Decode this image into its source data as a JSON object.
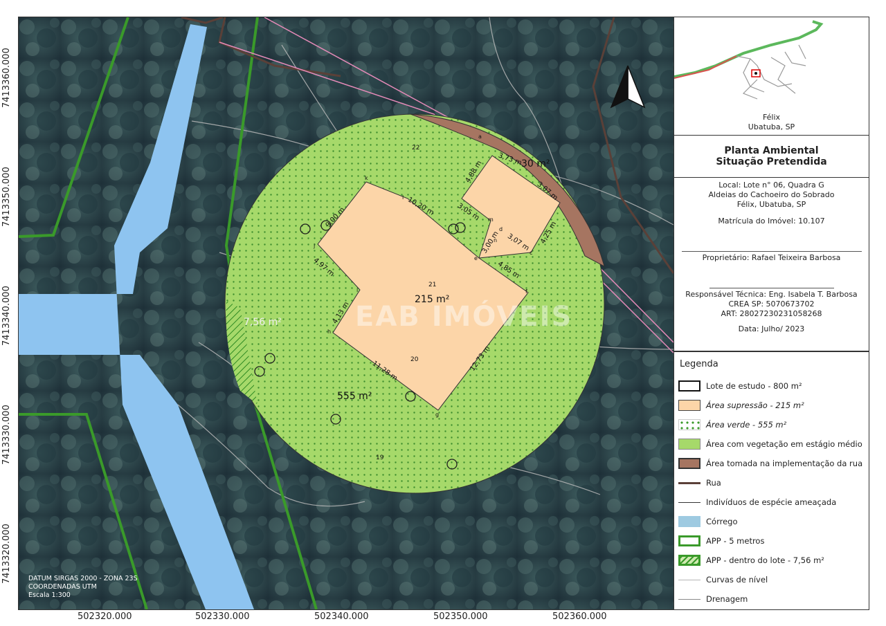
{
  "axes": {
    "y_ticks": [
      "7413360.000",
      "7413350.000",
      "7413340.000",
      "7413330.000",
      "7413320.000"
    ],
    "x_ticks": [
      "502320.000",
      "502330.000",
      "502340.000",
      "502350.000",
      "502360.000"
    ]
  },
  "map": {
    "areas": {
      "supressao": "215 m²",
      "verde": "555 m²",
      "rua": "30 m²",
      "app": "7,56 m²"
    },
    "dimensions": [
      "10,20 m",
      "4,97 m",
      "4,13 m",
      "11,28 m",
      "12,73 m",
      "4,85 m",
      "3,07 m",
      "3,00 m",
      "3,05 m",
      "4,88 m",
      "3,73 m",
      "3,07 m",
      "4,25 m",
      "9,00 m"
    ],
    "contours": [
      "22",
      "21",
      "20",
      "19"
    ],
    "vertex_labels": [
      "m",
      "n",
      "d",
      "e",
      "f",
      "g",
      "h",
      "i",
      "j",
      "k",
      "l",
      "c",
      "a"
    ],
    "watermark": "EAB IMÓVEIS",
    "datum": [
      "DATUM SIRGAS 2000 - ZONA 23S",
      "COORDENADAS UTM",
      "Escala 1:300"
    ]
  },
  "locator": {
    "place": "Félix",
    "city": "Ubatuba, SP"
  },
  "title": {
    "line1": "Planta Ambiental",
    "line2": "Situação Pretendida"
  },
  "info": {
    "local": "Local: Lote n° 06, Quadra G",
    "loteamento": "Aldeias do Cachoeiro do Sobrado",
    "cidade": "Félix, Ubatuba, SP",
    "matricula": "Matrícula do Imóvel: 10.107",
    "proprietario": "Proprietário: Rafael Teixeira Barbosa",
    "responsavel": "Responsável Técnica: Eng. Isabela T. Barbosa",
    "crea": "CREA SP: 5070673702",
    "art": "ART: 28027230231058268",
    "data": "Data: Julho/ 2023"
  },
  "legend": {
    "title": "Legenda",
    "items": [
      {
        "label": "Lote de estudo - 800 m²"
      },
      {
        "label": "Área supressão - 215 m²"
      },
      {
        "label": "Área verde - 555 m²"
      },
      {
        "label": "Área com vegetação em estágio médio"
      },
      {
        "label": "Área tomada na implementação da rua"
      },
      {
        "label": "Rua"
      },
      {
        "label": "Indivíduos de espécie ameaçada"
      },
      {
        "label": "Córrego"
      },
      {
        "label": "APP - 5 metros"
      },
      {
        "label": "APP - dentro do lote - 7,56 m²"
      },
      {
        "label": "Curvas de nível"
      },
      {
        "label": "Drenagem"
      }
    ],
    "colors": {
      "supressao": "#fcd5a8",
      "verde": "#a6d96a",
      "rua_area": "#a67561",
      "rua_line": "#5a4038",
      "corrego": "#8ec4f0",
      "app": "#3a9a2a",
      "curvas": "#b4b4b4"
    }
  }
}
